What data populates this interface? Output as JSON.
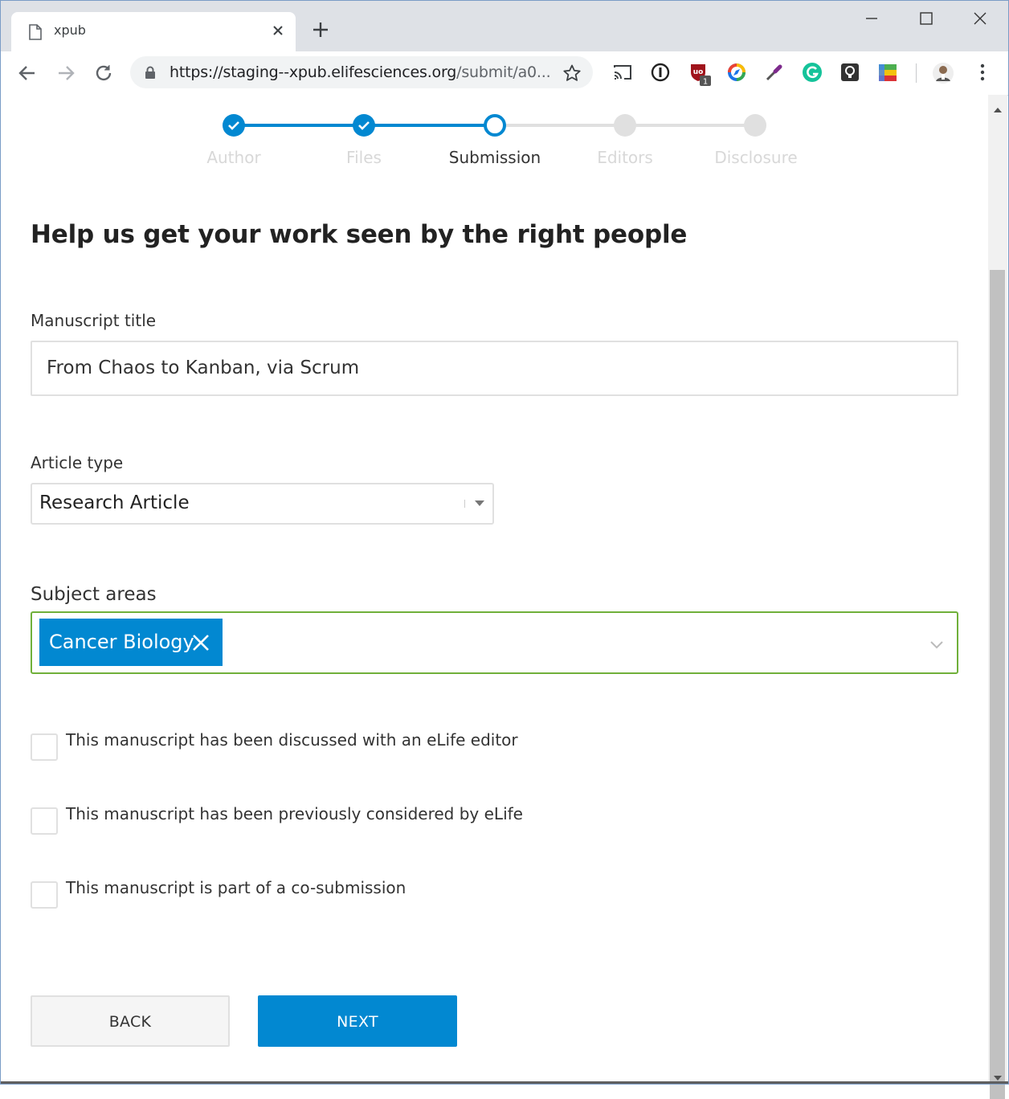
{
  "browser": {
    "tab_title": "xpub",
    "url_host": "https://staging--xpub.elifesciences.org",
    "url_path": "/submit/a0...",
    "icons": [
      "page-icon",
      "close-icon",
      "plus-icon",
      "minimize-icon",
      "maximize-icon",
      "window-close-icon",
      "back-arrow-icon",
      "forward-arrow-icon",
      "reload-icon",
      "lock-icon",
      "star-icon",
      "cast-icon",
      "password-icon",
      "ublock-icon",
      "compass-icon",
      "eyedropper-icon",
      "grammarly-icon",
      "keep-icon",
      "color-extension-icon",
      "profile-avatar",
      "more-menu-icon"
    ],
    "extension_badge": "1"
  },
  "stepper": {
    "steps": [
      {
        "label": "Author",
        "status": "done"
      },
      {
        "label": "Files",
        "status": "done"
      },
      {
        "label": "Submission",
        "status": "current"
      },
      {
        "label": "Editors",
        "status": "todo"
      },
      {
        "label": "Disclosure",
        "status": "todo"
      }
    ],
    "accent_color": "#0288d1"
  },
  "page": {
    "title": "Help us get your work seen by the right people"
  },
  "form": {
    "manuscript_title_label": "Manuscript title",
    "manuscript_title_value": "From Chaos to Kanban, via Scrum",
    "article_type_label": "Article type",
    "article_type_value": "Research Article",
    "subject_areas_label": "Subject areas",
    "subject_areas_selected": [
      "Cancer Biology"
    ],
    "subject_areas_border_color": "#70b03a",
    "checkboxes": [
      {
        "label": "This manuscript has been discussed with an eLife editor",
        "checked": false
      },
      {
        "label": "This manuscript has been previously considered by eLife",
        "checked": false
      },
      {
        "label": "This manuscript is part of a co-submission",
        "checked": false
      }
    ],
    "back_label": "BACK",
    "next_label": "NEXT"
  }
}
